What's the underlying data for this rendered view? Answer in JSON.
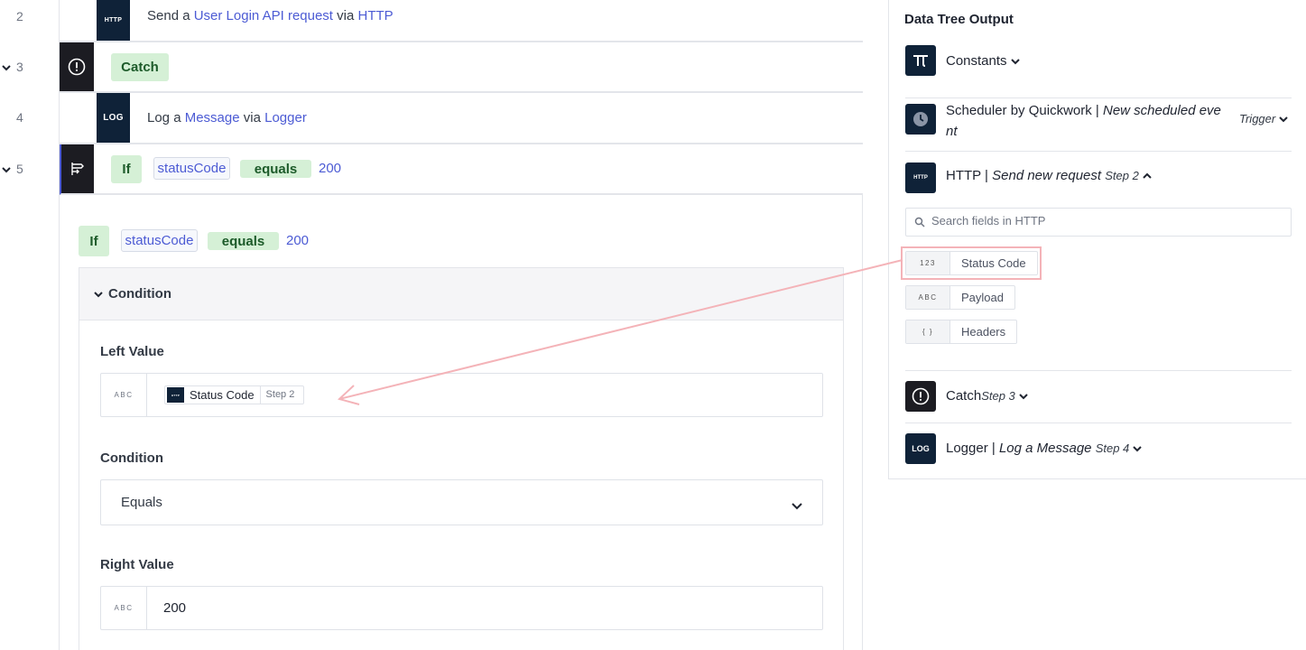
{
  "gutter": {
    "lines": [
      {
        "num": "2",
        "has_chevron": false
      },
      {
        "num": "3",
        "has_chevron": true
      },
      {
        "num": "4",
        "has_chevron": false
      },
      {
        "num": "5",
        "has_chevron": true
      }
    ]
  },
  "steps": {
    "http": {
      "icon_text": "HTTP",
      "pre": "Send a",
      "link1": "User Login API request",
      "mid": "via",
      "link2": "HTTP"
    },
    "catch": {
      "label": "Catch"
    },
    "log": {
      "icon_text": "LOG",
      "pre": "Log a",
      "link1": "Message",
      "mid": "via",
      "link2": "Logger"
    },
    "if": {
      "keyword": "If",
      "field": "statusCode",
      "operator": "equals",
      "value": "200"
    }
  },
  "editor": {
    "summary": {
      "keyword": "If",
      "field": "statusCode",
      "operator": "equals",
      "value": "200"
    },
    "section_title": "Condition",
    "left_value": {
      "label": "Left Value",
      "type": "ABC",
      "token_icon": "HTTP",
      "token_label": "Status Code",
      "token_step": "Step 2"
    },
    "condition": {
      "label": "Condition",
      "selected": "Equals"
    },
    "right_value": {
      "label": "Right Value",
      "type": "ABC",
      "value": "200"
    }
  },
  "data_tree": {
    "title": "Data Tree Output",
    "constants": {
      "label": "Constants",
      "icon": "pi-icon"
    },
    "scheduler": {
      "name": "Scheduler by Quickwork |",
      "event_line1": "New scheduled eve",
      "event_line2": "nt",
      "tag": "Trigger"
    },
    "http": {
      "icon_text": "HTTP",
      "name": "HTTP |",
      "action": "Send new request",
      "step": "Step 2",
      "search_placeholder": "Search fields in HTTP",
      "fields": [
        {
          "type": "123",
          "name": "Status Code"
        },
        {
          "type": "ABC",
          "name": "Payload"
        },
        {
          "type": "{ }",
          "name": "Headers"
        }
      ]
    },
    "catch": {
      "name": "Catch",
      "step": "Step 3"
    },
    "logger": {
      "icon_text": "LOG",
      "name": "Logger |",
      "action": "Log a Message",
      "step": "Step 4"
    }
  },
  "colors": {
    "accent_link": "#4c5bd4",
    "pill_green_bg": "#d5f0d6",
    "icon_navy": "#0f2238",
    "highlight_pink": "#f4b3b8"
  }
}
